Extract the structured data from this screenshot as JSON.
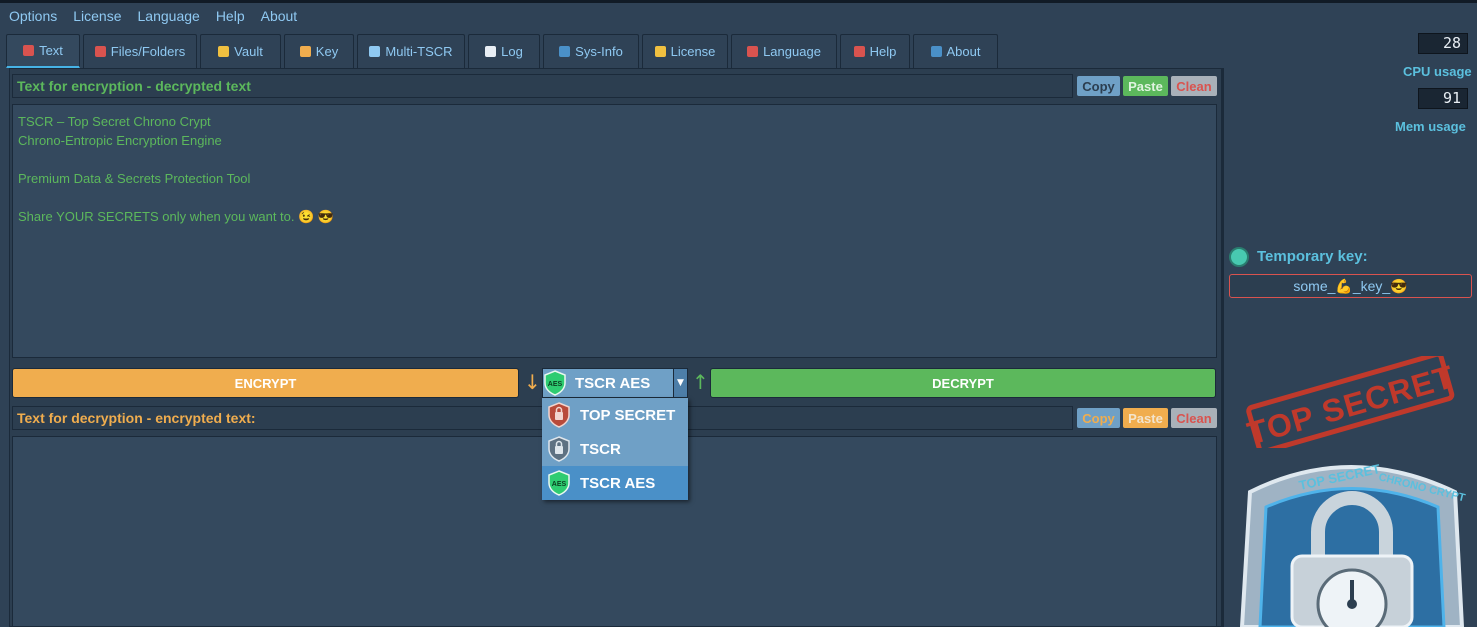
{
  "menu": [
    "Options",
    "License",
    "Language",
    "Help",
    "About"
  ],
  "tabs": [
    {
      "label": "Text",
      "icon": "text-ab-icon",
      "color": "#d9534f",
      "active": true,
      "width": 74
    },
    {
      "label": "Files/Folders",
      "icon": "shield-icon",
      "color": "#d9534f",
      "width": 114
    },
    {
      "label": "Vault",
      "icon": "padlock-icon",
      "color": "#f0c040",
      "width": 81
    },
    {
      "label": "Key",
      "icon": "key-icon",
      "color": "#f0ad4e",
      "width": 70
    },
    {
      "label": "Multi-TSCR",
      "icon": "m-circle-icon",
      "color": "#8fc9f2",
      "width": 108
    },
    {
      "label": "Log",
      "icon": "document-icon",
      "color": "#e8eef4",
      "width": 72
    },
    {
      "label": "Sys-Info",
      "icon": "chart-icon",
      "color": "#4a90c8",
      "width": 96
    },
    {
      "label": "License",
      "icon": "medal-icon",
      "color": "#f0c040",
      "width": 86
    },
    {
      "label": "Language",
      "icon": "shield-icon",
      "color": "#d9534f",
      "width": 106
    },
    {
      "label": "Help",
      "icon": "question-icon",
      "color": "#d9534f",
      "width": 70
    },
    {
      "label": "About",
      "icon": "window-icon",
      "color": "#4a90c8",
      "width": 85
    }
  ],
  "encrypt_section": {
    "title": "Text for encryption - decrypted text",
    "lines": [
      "TSCR – Top Secret Chrono Crypt",
      "Chrono-Entropic Encryption Engine",
      "",
      "Premium Data & Secrets Protection Tool",
      "",
      "Share YOUR SECRETS only when you want to. 😉 😎"
    ]
  },
  "decrypt_section": {
    "title": "Text for decryption - encrypted text:",
    "text": ""
  },
  "buttons": {
    "copy": "Copy",
    "paste": "Paste",
    "clean": "Clean",
    "encrypt": "ENCRYPT",
    "decrypt": "DECRYPT"
  },
  "algorithm": {
    "selected": "TSCR AES",
    "options": [
      {
        "label": "TOP SECRET",
        "icon": "red-shield-icon"
      },
      {
        "label": "TSCR",
        "icon": "gray-shield-icon"
      },
      {
        "label": "TSCR AES",
        "icon": "aes-shield-icon",
        "selected": true
      }
    ]
  },
  "system": {
    "cpu_value": "28",
    "cpu_label": "CPU usage",
    "mem_value": "91",
    "mem_label": "Mem usage"
  },
  "temp_key": {
    "label": "Temporary key:",
    "value": "some_💪_key_😎"
  },
  "branding": {
    "stamp_text": "TOP SECRET",
    "lock_text": "TOP SECRET CHRONO CRYPT"
  },
  "colors": {
    "background": "#2f4256",
    "encrypt": "#f0ad4e",
    "decrypt": "#5cb85c",
    "accent": "#5bc0de"
  }
}
